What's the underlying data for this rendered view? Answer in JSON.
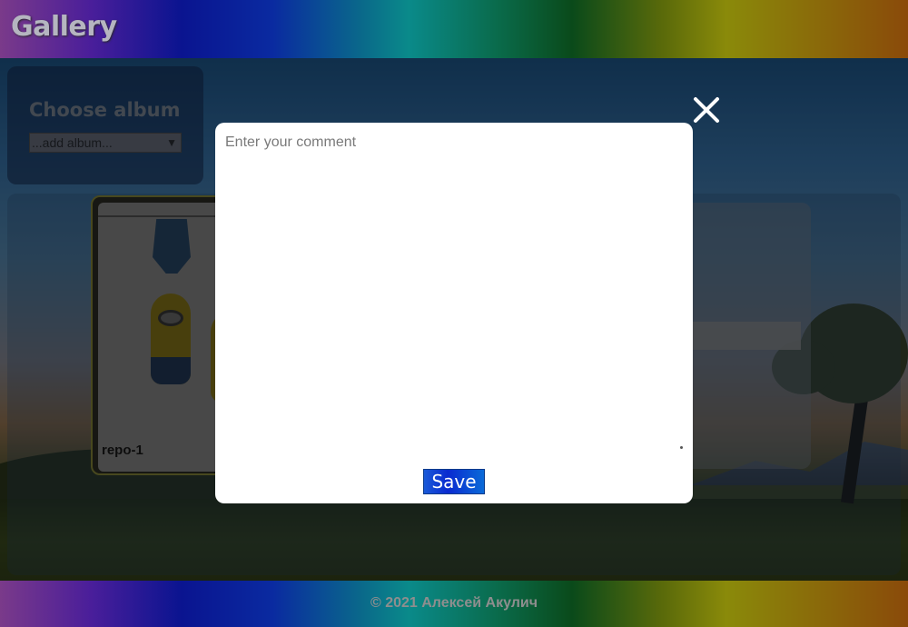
{
  "header": {
    "title": "Gallery"
  },
  "sidebar": {
    "title": "Choose album",
    "album_select": {
      "selected": "...add album..."
    }
  },
  "gallery": {
    "cards": [
      {
        "label": "repo-1"
      }
    ]
  },
  "modal": {
    "comment": {
      "placeholder": "Enter your comment",
      "value": ""
    },
    "save_label": "Save"
  },
  "footer": {
    "text": "© 2021 Алексей Акулич"
  },
  "colors": {
    "save_button": "#0a2ad0",
    "modal_background": "#ffffff",
    "overlay": "rgba(0,0,0,0.48)"
  },
  "icons": {
    "close": "close-icon",
    "dropdown": "chevron-down-icon"
  }
}
